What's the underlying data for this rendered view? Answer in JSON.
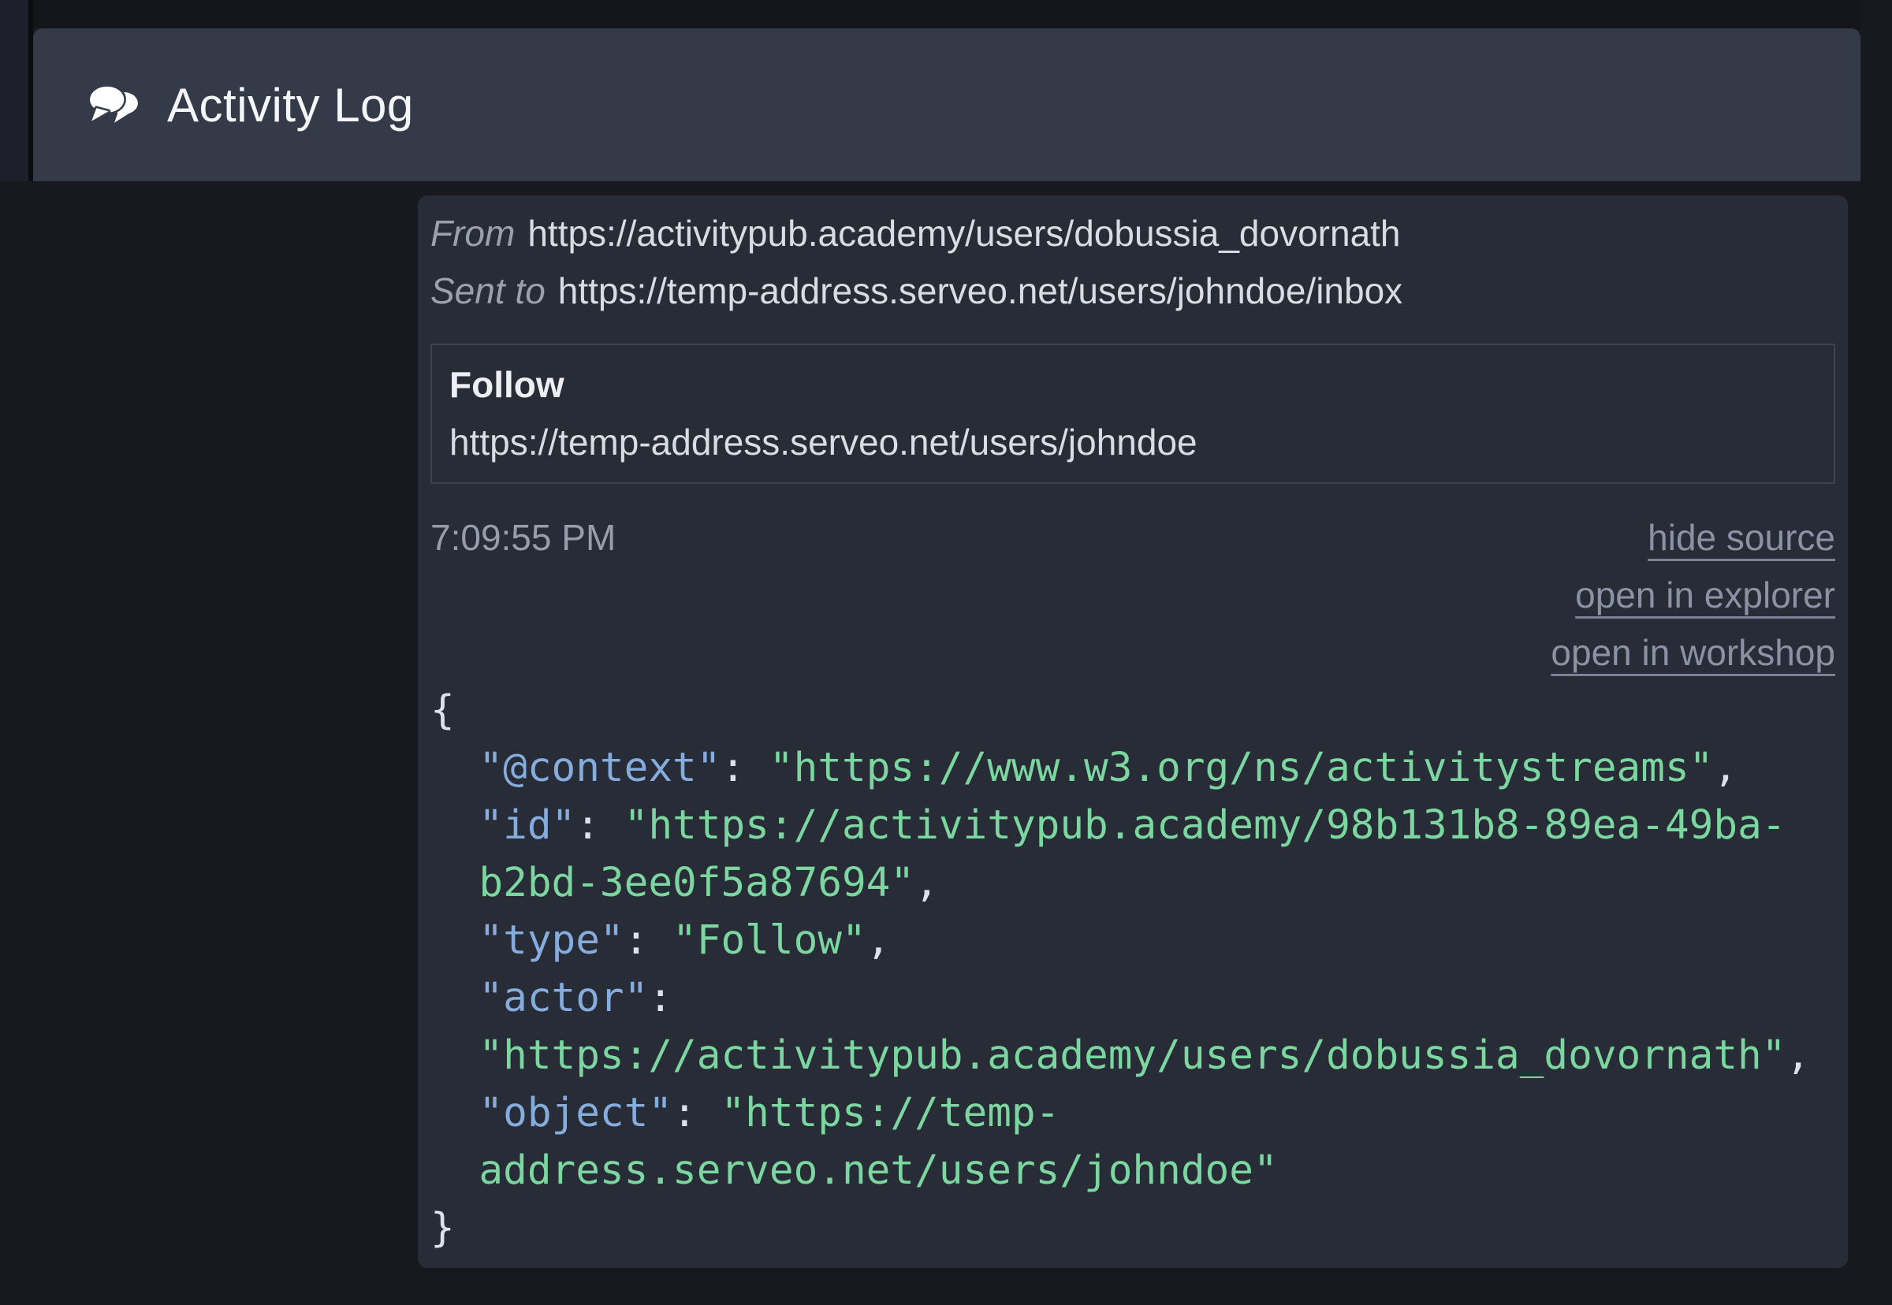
{
  "header": {
    "title": "Activity Log"
  },
  "entry": {
    "from_label": "From",
    "from_value": "https://activitypub.academy/users/dobussia_dovornath",
    "sent_to_label": "Sent to",
    "sent_to_value": "https://temp-address.serveo.net/users/johndoe/inbox",
    "activity": {
      "type": "Follow",
      "object": "https://temp-address.serveo.net/users/johndoe"
    },
    "timestamp": "7:09:55 PM",
    "links": [
      "hide source",
      "open in explorer",
      "open in workshop"
    ],
    "source": {
      "lines": [
        {
          "indent": 0,
          "segments": [
            {
              "type": "punct",
              "text": "{"
            }
          ]
        },
        {
          "indent": 1,
          "segments": [
            {
              "type": "key",
              "text": "\"@context\""
            },
            {
              "type": "punct",
              "text": ": "
            },
            {
              "type": "string",
              "text": "\"https://www.w3.org/ns/activitystreams\""
            },
            {
              "type": "punct",
              "text": ","
            }
          ]
        },
        {
          "indent": 1,
          "segments": [
            {
              "type": "key",
              "text": "\"id\""
            },
            {
              "type": "punct",
              "text": ": "
            },
            {
              "type": "string",
              "text": "\"https://activitypub.academy/98b131b8-89ea-49ba-b2bd-3ee0f5a87694\""
            },
            {
              "type": "punct",
              "text": ","
            }
          ]
        },
        {
          "indent": 1,
          "segments": [
            {
              "type": "key",
              "text": "\"type\""
            },
            {
              "type": "punct",
              "text": ": "
            },
            {
              "type": "string",
              "text": "\"Follow\""
            },
            {
              "type": "punct",
              "text": ","
            }
          ]
        },
        {
          "indent": 1,
          "segments": [
            {
              "type": "key",
              "text": "\"actor\""
            },
            {
              "type": "punct",
              "text": ": "
            },
            {
              "type": "string",
              "text": "\"https://activitypub.academy/users/dobussia_dovornath\""
            },
            {
              "type": "punct",
              "text": ","
            }
          ]
        },
        {
          "indent": 1,
          "segments": [
            {
              "type": "key",
              "text": "\"object\""
            },
            {
              "type": "punct",
              "text": ": "
            },
            {
              "type": "string",
              "text": "\"https://temp-address.serveo.net/users/johndoe\""
            }
          ]
        },
        {
          "indent": 0,
          "segments": [
            {
              "type": "punct",
              "text": "}"
            }
          ]
        }
      ]
    }
  },
  "colors": {
    "page_bg": "#17191f",
    "top_strip": "#14161c",
    "sliver": "#1d202a",
    "separator": "#0b0c10",
    "header_bg": "#353a49",
    "title_color": "#f4f6f9",
    "panel_bg": "#282c37",
    "text": "#d9dce3",
    "muted": "#9aa1ae",
    "muted2": "#969dab",
    "link": "#8b92a3",
    "box_border": "#3d4352",
    "type_color": "#edeff3",
    "code_key": "#85acdd",
    "code_string": "#7bd6a0",
    "code_punct": "#dde1ea"
  }
}
